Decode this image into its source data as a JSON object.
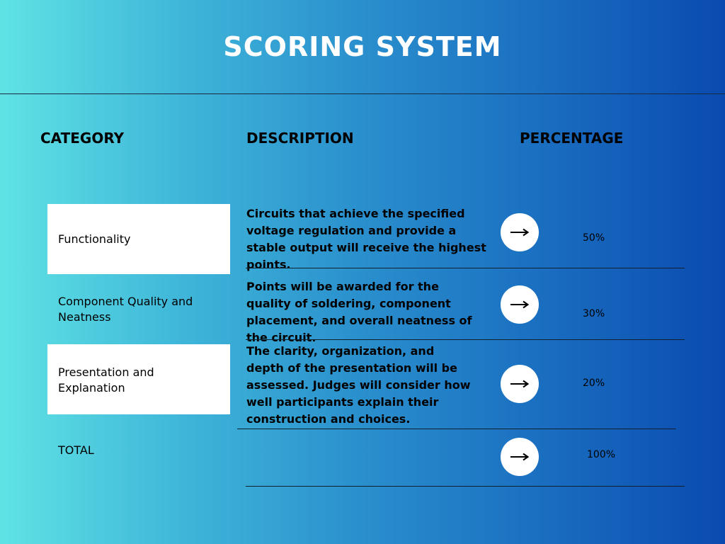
{
  "title": "SCORING SYSTEM",
  "headers": {
    "category": "CATEGORY",
    "description": "DESCRIPTION",
    "percentage": "PERCENTAGE"
  },
  "rows": [
    {
      "category": "Functionality",
      "description": "Circuits that achieve the specified voltage regulation and provide a stable output will receive the highest points.",
      "percentage": "50%"
    },
    {
      "category": "Component Quality and Neatness",
      "description": "Points will be awarded for the quality of soldering, component placement, and overall neatness of the circuit.",
      "percentage": "30%"
    },
    {
      "category": "Presentation and Explanation",
      "description": "The clarity, organization, and depth of the presentation will be assessed. Judges will consider how well participants explain their construction and choices.",
      "percentage": "20%"
    },
    {
      "category": "TOTAL",
      "description": "",
      "percentage": "100%"
    }
  ],
  "icons": {
    "arrow": "arrow-right-icon"
  },
  "colors": {
    "gradient_start": "#5fe3e4",
    "gradient_end": "#0a4ab0",
    "title": "#ffffff",
    "box": "#ffffff"
  }
}
